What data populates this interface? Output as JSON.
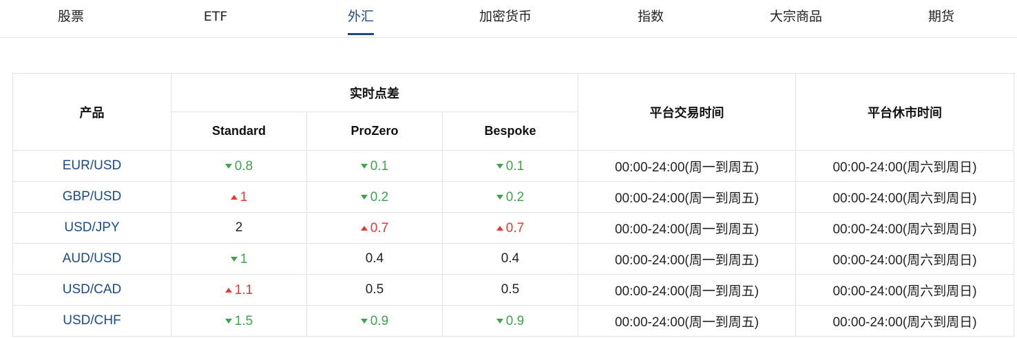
{
  "tabs": [
    {
      "label": "股票",
      "active": false
    },
    {
      "label": "ETF",
      "active": false
    },
    {
      "label": "外汇",
      "active": true
    },
    {
      "label": "加密货币",
      "active": false
    },
    {
      "label": "指数",
      "active": false
    },
    {
      "label": "大宗商品",
      "active": false
    },
    {
      "label": "期货",
      "active": false
    }
  ],
  "table": {
    "headers": {
      "product": "产品",
      "spread_group": "实时点差",
      "standard": "Standard",
      "prozero": "ProZero",
      "bespoke": "Bespoke",
      "trading_hours": "平台交易时间",
      "closed_hours": "平台休市时间"
    },
    "rows": [
      {
        "product": "EUR/USD",
        "standard": {
          "value": "0.8",
          "dir": "down"
        },
        "prozero": {
          "value": "0.1",
          "dir": "down"
        },
        "bespoke": {
          "value": "0.1",
          "dir": "down"
        },
        "trading_hours": "00:00-24:00(周一到周五)",
        "closed_hours": "00:00-24:00(周六到周日)"
      },
      {
        "product": "GBP/USD",
        "standard": {
          "value": "1",
          "dir": "up"
        },
        "prozero": {
          "value": "0.2",
          "dir": "down"
        },
        "bespoke": {
          "value": "0.2",
          "dir": "down"
        },
        "trading_hours": "00:00-24:00(周一到周五)",
        "closed_hours": "00:00-24:00(周六到周日)"
      },
      {
        "product": "USD/JPY",
        "standard": {
          "value": "2",
          "dir": "none"
        },
        "prozero": {
          "value": "0.7",
          "dir": "up"
        },
        "bespoke": {
          "value": "0.7",
          "dir": "up"
        },
        "trading_hours": "00:00-24:00(周一到周五)",
        "closed_hours": "00:00-24:00(周六到周日)"
      },
      {
        "product": "AUD/USD",
        "standard": {
          "value": "1",
          "dir": "down"
        },
        "prozero": {
          "value": "0.4",
          "dir": "none"
        },
        "bespoke": {
          "value": "0.4",
          "dir": "none"
        },
        "trading_hours": "00:00-24:00(周一到周五)",
        "closed_hours": "00:00-24:00(周六到周日)"
      },
      {
        "product": "USD/CAD",
        "standard": {
          "value": "1.1",
          "dir": "up"
        },
        "prozero": {
          "value": "0.5",
          "dir": "none"
        },
        "bespoke": {
          "value": "0.5",
          "dir": "none"
        },
        "trading_hours": "00:00-24:00(周一到周五)",
        "closed_hours": "00:00-24:00(周六到周日)"
      },
      {
        "product": "USD/CHF",
        "standard": {
          "value": "1.5",
          "dir": "down"
        },
        "prozero": {
          "value": "0.9",
          "dir": "down"
        },
        "bespoke": {
          "value": "0.9",
          "dir": "down"
        },
        "trading_hours": "00:00-24:00(周一到周五)",
        "closed_hours": "00:00-24:00(周六到周日)"
      }
    ]
  },
  "colors": {
    "accent": "#1a4a8a",
    "down": "#3fa34d",
    "up": "#e53935",
    "border": "#e3e3e3"
  }
}
